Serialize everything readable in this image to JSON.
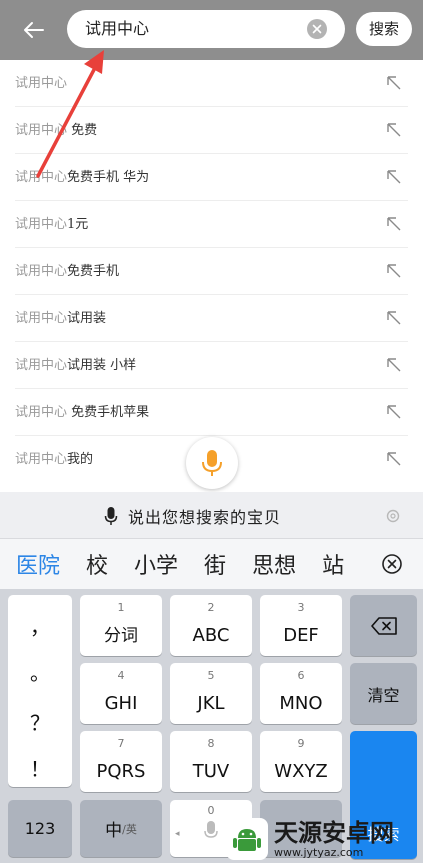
{
  "search": {
    "query": "试用中心",
    "button_label": "搜索"
  },
  "suggestions": [
    {
      "prefix": "试用中心",
      "rest": ""
    },
    {
      "prefix": "试用中心",
      "rest": " 免费"
    },
    {
      "prefix": "试用中心",
      "rest": "免费手机 华为"
    },
    {
      "prefix": "试用中心",
      "rest": "1元"
    },
    {
      "prefix": "试用中心",
      "rest": "免费手机"
    },
    {
      "prefix": "试用中心",
      "rest": "试用装"
    },
    {
      "prefix": "试用中心",
      "rest": "试用装 小样"
    },
    {
      "prefix": "试用中心",
      "rest": " 免费手机苹果"
    },
    {
      "prefix": "试用中心",
      "rest": "我的"
    }
  ],
  "voice": {
    "hint": "说出您想搜索的宝贝"
  },
  "candidates": [
    "医院",
    "校",
    "小学",
    "街",
    "思想",
    "站"
  ],
  "keyboard": {
    "punctuation": [
      "，",
      "。",
      "？",
      "！"
    ],
    "row1": [
      {
        "num": "1",
        "label": "分词"
      },
      {
        "num": "2",
        "label": "ABC"
      },
      {
        "num": "3",
        "label": "DEF"
      }
    ],
    "row2": [
      {
        "num": "4",
        "label": "GHI"
      },
      {
        "num": "5",
        "label": "JKL"
      },
      {
        "num": "6",
        "label": "MNO"
      }
    ],
    "row3": [
      {
        "num": "7",
        "label": "PQRS"
      },
      {
        "num": "8",
        "label": "TUV"
      },
      {
        "num": "9",
        "label": "WXYZ"
      }
    ],
    "clear_label": "清空",
    "search_label": "搜索",
    "num_switch_label": "123",
    "lang_main": "中",
    "lang_sub": "/英",
    "space_num": "0"
  },
  "watermark": {
    "title": "天源安卓网",
    "url": "www.jytyaz.com"
  },
  "colors": {
    "topbar": "#8e8e8e",
    "accent_blue": "#1a86f0",
    "mic_orange": "#f5a02a",
    "annotation_red": "#e8403a"
  }
}
